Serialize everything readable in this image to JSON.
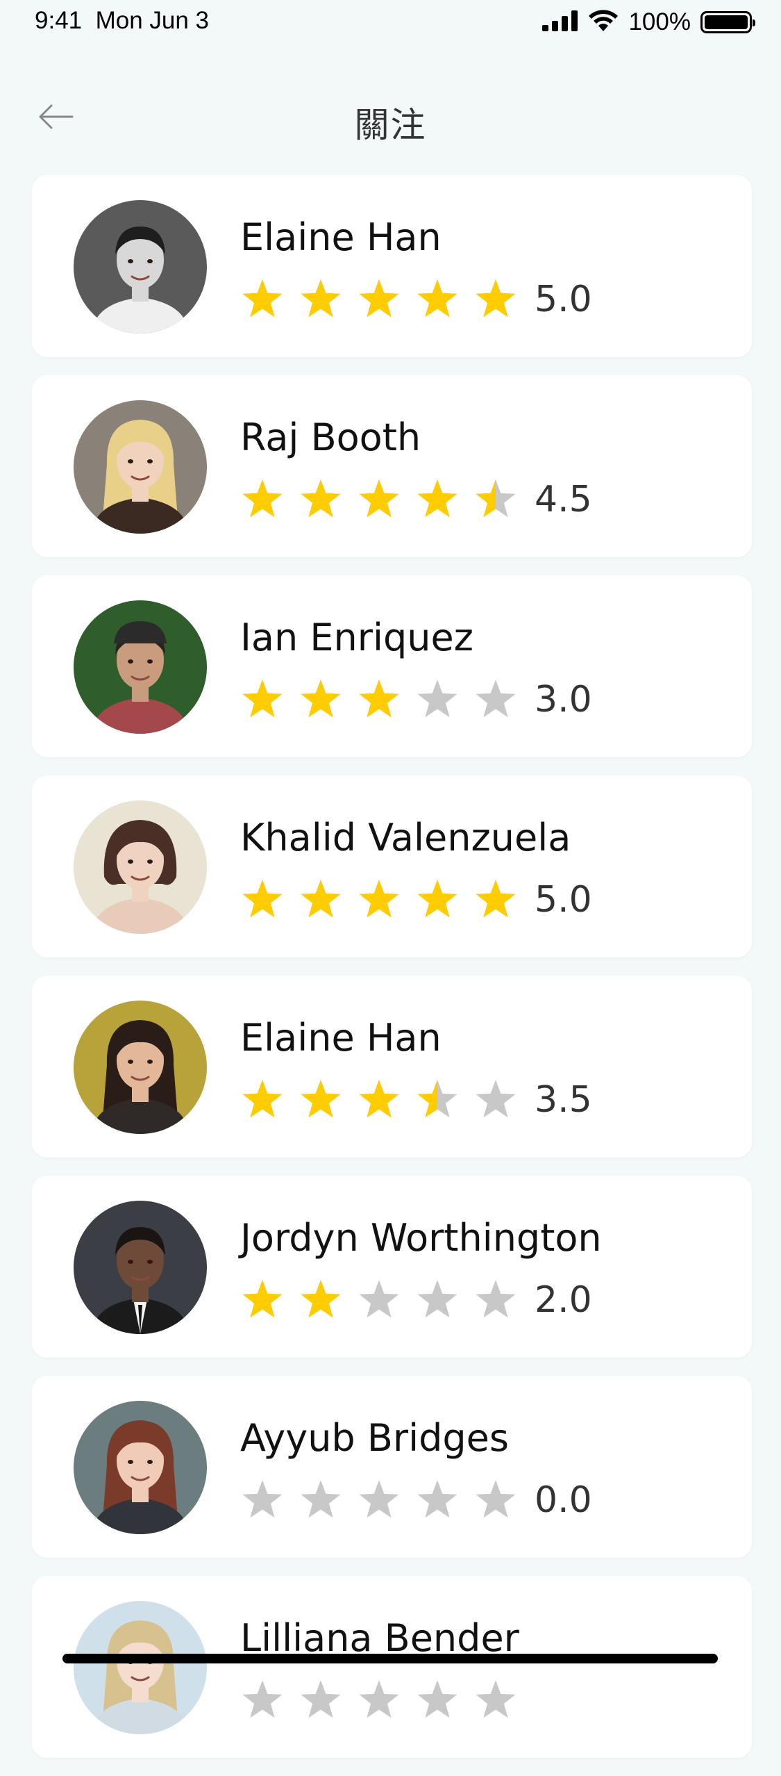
{
  "status_bar": {
    "time": "9:41",
    "date": "Mon Jun 3",
    "battery": "100%",
    "battery_level": 1.0
  },
  "nav": {
    "title": "關注"
  },
  "colors": {
    "star_filled": "#FFCC00",
    "star_empty": "#C8C8C8",
    "background": "#F3F9F9",
    "card": "#FFFFFF"
  },
  "followed_users": [
    {
      "name": "Elaine Han",
      "rating_value": 5.0,
      "rating_label": "5.0"
    },
    {
      "name": "Raj Booth",
      "rating_value": 4.5,
      "rating_label": "4.5"
    },
    {
      "name": "Ian Enriquez",
      "rating_value": 3.0,
      "rating_label": "3.0"
    },
    {
      "name": "Khalid Valenzuela",
      "rating_value": 5.0,
      "rating_label": "5.0"
    },
    {
      "name": "Elaine Han",
      "rating_value": 3.5,
      "rating_label": "3.5"
    },
    {
      "name": "Jordyn Worthington",
      "rating_value": 2.0,
      "rating_label": "2.0"
    },
    {
      "name": "Ayyub Bridges",
      "rating_value": 0.0,
      "rating_label": "0.0"
    },
    {
      "name": "Lilliana Bender",
      "rating_value": 0.0,
      "rating_label": ""
    }
  ]
}
